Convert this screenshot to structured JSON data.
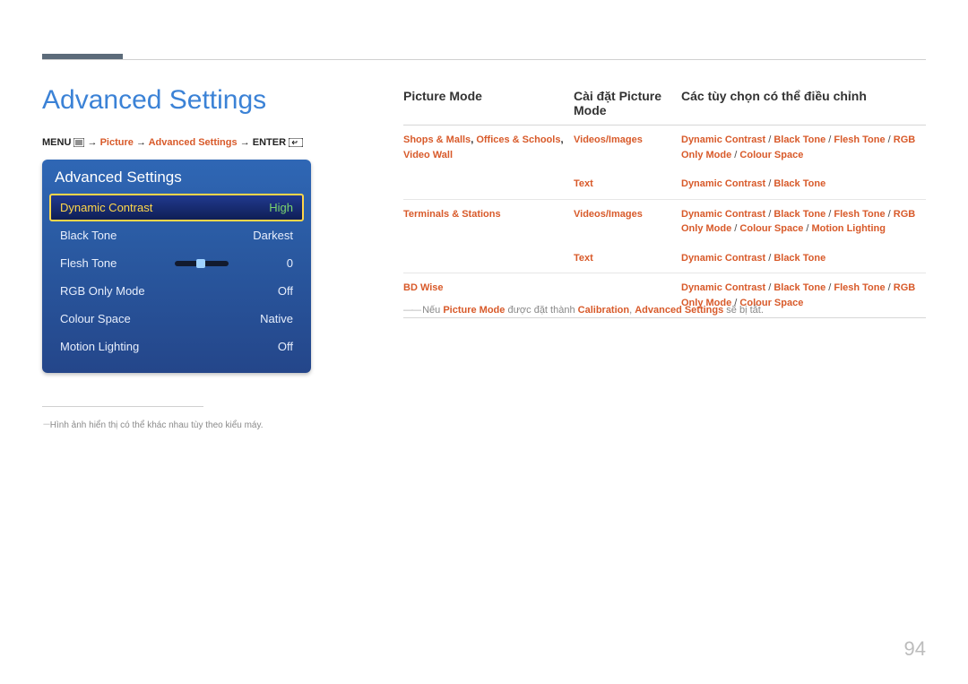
{
  "page_number": "94",
  "title": "Advanced Settings",
  "breadcrumb": {
    "menu": "MENU",
    "arrow": "→",
    "p1": "Picture",
    "p2": "Advanced Settings",
    "enter": "ENTER"
  },
  "osd": {
    "title": "Advanced Settings",
    "rows": [
      {
        "label": "Dynamic Contrast",
        "value": "High",
        "selected": true
      },
      {
        "label": "Black Tone",
        "value": "Darkest"
      },
      {
        "label": "Flesh Tone",
        "value": "0",
        "slider": true
      },
      {
        "label": "RGB Only Mode",
        "value": "Off"
      },
      {
        "label": "Colour Space",
        "value": "Native"
      },
      {
        "label": "Motion Lighting",
        "value": "Off"
      }
    ],
    "footnote": "Hình ảnh hiển thị có thể khác nhau tùy theo kiểu máy."
  },
  "table": {
    "headers": {
      "c1": "Picture Mode",
      "c2": "Cài đặt Picture Mode",
      "c3": "Các tùy chọn có thể điều chỉnh"
    },
    "rows": [
      {
        "c1_html": "<span class='orange'>Shops & Malls</span><span class='blk'>, </span><span class='orange'>Offices & Schools</span><span class='blk'>, </span><span class='orange'>Video Wall</span>",
        "sub": [
          {
            "c2": "Videos/Images",
            "c3": "<span class='orange'>Dynamic Contrast</span> / <span class='orange'>Black Tone</span> / <span class='orange'>Flesh Tone</span> / <span class='orange'>RGB Only Mode</span> / <span class='orange'>Colour Space</span>"
          },
          {
            "c2": "Text",
            "c3": "<span class='orange'>Dynamic Contrast</span> / <span class='orange'>Black Tone</span>"
          }
        ]
      },
      {
        "c1_html": "<span class='orange'>Terminals & Stations</span>",
        "sub": [
          {
            "c2": "Videos/Images",
            "c3": "<span class='orange'>Dynamic Contrast</span> / <span class='orange'>Black Tone</span> / <span class='orange'>Flesh Tone</span> / <span class='orange'>RGB Only Mode</span> / <span class='orange'>Colour Space</span> / <span class='orange'>Motion Lighting</span>"
          },
          {
            "c2": "Text",
            "c3": "<span class='orange'>Dynamic Contrast</span> / <span class='orange'>Black Tone</span>"
          }
        ]
      },
      {
        "c1_html": "<span class='orange'>BD Wise</span>",
        "sub": [
          {
            "c2": "",
            "c3": "<span class='orange'>Dynamic Contrast</span> / <span class='orange'>Black Tone</span> / <span class='orange'>Flesh Tone</span> / <span class='orange'>RGB Only Mode</span> / <span class='orange'>Colour Space</span>"
          }
        ]
      }
    ]
  },
  "note": {
    "pre": "Nếu ",
    "pm": "Picture Mode",
    "mid1": " được đặt thành ",
    "cal": "Calibration",
    "mid2": ", ",
    "as": "Advanced Settings",
    "post": " sẽ bị tắt."
  }
}
